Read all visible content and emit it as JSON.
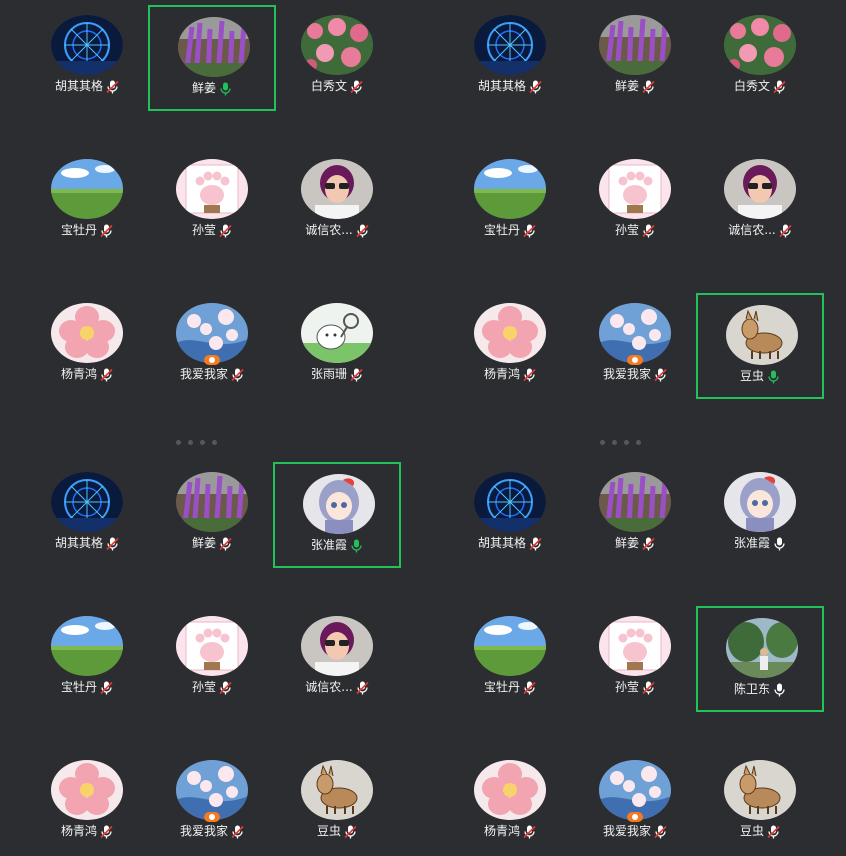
{
  "colors": {
    "background": "#2b2d30",
    "speaking_border": "#21c25a",
    "mic_active": "#21c25a",
    "mic_muted": "#ffffff",
    "mic_muted_slash": "#e53935",
    "host_badge": "#f47b20"
  },
  "panels": [
    {
      "participants": [
        {
          "name": "胡其其格",
          "mic": "muted",
          "avatar": "ferris-wheel"
        },
        {
          "name": "鲜姜",
          "mic": "speaking",
          "avatar": "purple-flowers",
          "speaking": true
        },
        {
          "name": "白秀文",
          "mic": "muted",
          "avatar": "pink-roses"
        },
        {
          "name": "宝牡丹",
          "mic": "muted",
          "avatar": "grassland"
        },
        {
          "name": "孙莹",
          "mic": "muted",
          "avatar": "cat-paw"
        },
        {
          "name": "诚信农...",
          "mic": "muted",
          "avatar": "woman-sunglasses"
        },
        {
          "name": "杨青鸿",
          "mic": "muted",
          "avatar": "peach-blossom"
        },
        {
          "name": "我爱我家",
          "mic": "muted",
          "avatar": "cherry-blossom",
          "host": true
        },
        {
          "name": "张雨珊",
          "mic": "muted",
          "avatar": "cartoon-racket"
        }
      ]
    },
    {
      "participants": [
        {
          "name": "胡其其格",
          "mic": "muted",
          "avatar": "ferris-wheel"
        },
        {
          "name": "鲜姜",
          "mic": "muted",
          "avatar": "purple-flowers"
        },
        {
          "name": "白秀文",
          "mic": "muted",
          "avatar": "pink-roses"
        },
        {
          "name": "宝牡丹",
          "mic": "muted",
          "avatar": "grassland"
        },
        {
          "name": "孙莹",
          "mic": "muted",
          "avatar": "cat-paw"
        },
        {
          "name": "诚信农...",
          "mic": "muted",
          "avatar": "woman-sunglasses"
        },
        {
          "name": "杨青鸿",
          "mic": "muted",
          "avatar": "peach-blossom"
        },
        {
          "name": "我爱我家",
          "mic": "muted",
          "avatar": "cherry-blossom",
          "host": true
        },
        {
          "name": "豆虫",
          "mic": "speaking",
          "avatar": "donkey-cartoon",
          "speaking": true
        }
      ]
    },
    {
      "participants": [
        {
          "name": "胡其其格",
          "mic": "muted",
          "avatar": "ferris-wheel"
        },
        {
          "name": "鲜姜",
          "mic": "muted",
          "avatar": "purple-flowers"
        },
        {
          "name": "张准霞",
          "mic": "speaking",
          "avatar": "anime-girl",
          "speaking": true
        },
        {
          "name": "宝牡丹",
          "mic": "muted",
          "avatar": "grassland"
        },
        {
          "name": "孙莹",
          "mic": "muted",
          "avatar": "cat-paw"
        },
        {
          "name": "诚信农...",
          "mic": "muted",
          "avatar": "woman-sunglasses"
        },
        {
          "name": "杨青鸿",
          "mic": "muted",
          "avatar": "peach-blossom"
        },
        {
          "name": "我爱我家",
          "mic": "muted",
          "avatar": "cherry-blossom",
          "host": true
        },
        {
          "name": "豆虫",
          "mic": "muted",
          "avatar": "donkey-cartoon"
        }
      ]
    },
    {
      "participants": [
        {
          "name": "胡其其格",
          "mic": "muted",
          "avatar": "ferris-wheel"
        },
        {
          "name": "鲜姜",
          "mic": "muted",
          "avatar": "purple-flowers"
        },
        {
          "name": "张准霞",
          "mic": "on",
          "avatar": "anime-girl"
        },
        {
          "name": "宝牡丹",
          "mic": "muted",
          "avatar": "grassland"
        },
        {
          "name": "孙莹",
          "mic": "muted",
          "avatar": "cat-paw"
        },
        {
          "name": "陈卫东",
          "mic": "on",
          "avatar": "man-outdoors",
          "speaking": true
        },
        {
          "name": "杨青鸿",
          "mic": "muted",
          "avatar": "peach-blossom"
        },
        {
          "name": "我爱我家",
          "mic": "muted",
          "avatar": "cherry-blossom",
          "host": true
        },
        {
          "name": "豆虫",
          "mic": "muted",
          "avatar": "donkey-cartoon"
        }
      ]
    }
  ]
}
